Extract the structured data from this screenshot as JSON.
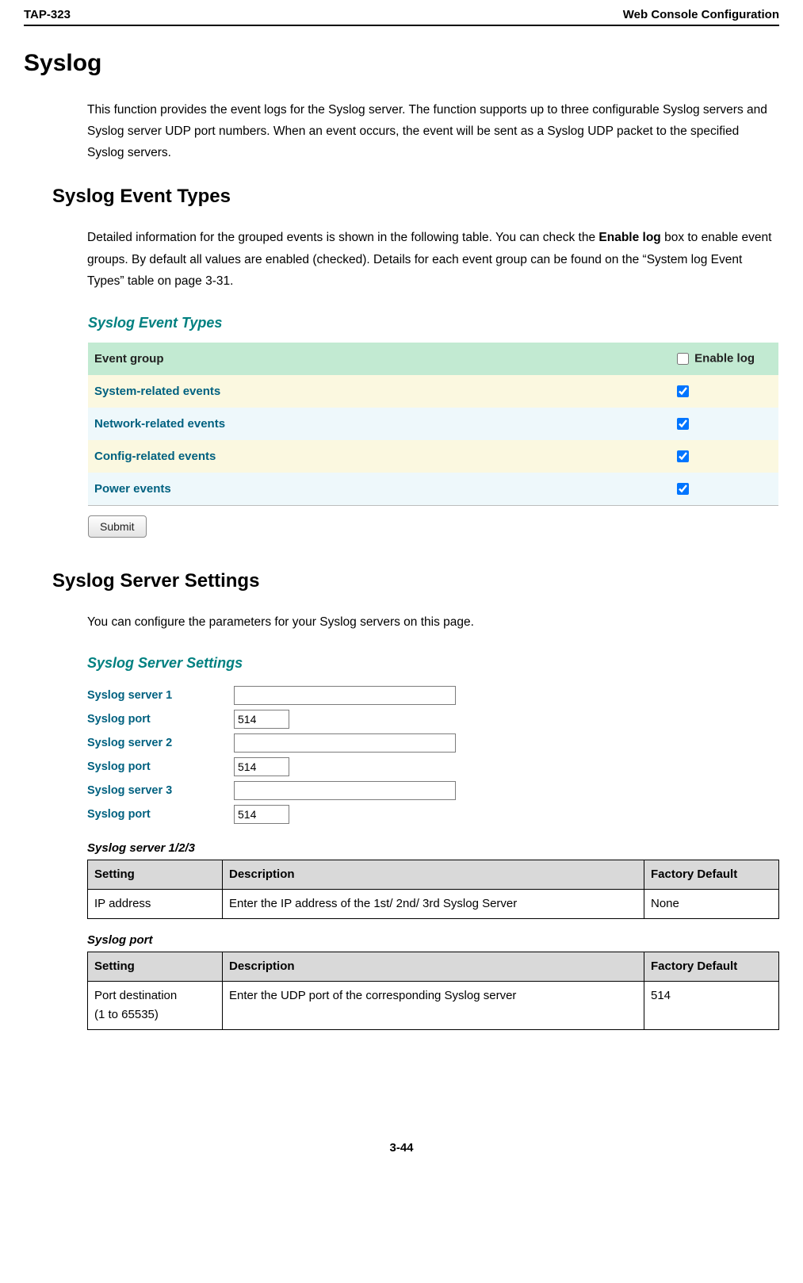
{
  "header": {
    "left": "TAP-323",
    "right": "Web Console Configuration"
  },
  "h1": "Syslog",
  "intro": "This function provides the event logs for the Syslog server. The function supports up to three configurable Syslog servers and Syslog server UDP port numbers. When an event occurs, the event will be sent as a Syslog UDP packet to the specified Syslog servers.",
  "h2_event_types": "Syslog Event Types",
  "event_types_text_pre": "Detailed information for the grouped events is shown in the following table. You can check the ",
  "event_types_text_bold": "Enable log",
  "event_types_text_post": " box to enable event groups. By default all values are enabled (checked). Details for each event group can be found on the “System log Event Types” table on page 3-31.",
  "panel_event_types": {
    "title": "Syslog Event Types",
    "header_group": "Event group",
    "header_enable": "Enable log",
    "rows": [
      {
        "label": "System-related events",
        "checked": true
      },
      {
        "label": "Network-related events",
        "checked": true
      },
      {
        "label": "Config-related events",
        "checked": true
      },
      {
        "label": "Power events",
        "checked": true
      }
    ],
    "submit": "Submit"
  },
  "h2_server_settings": "Syslog Server Settings",
  "server_settings_text": "You can configure the parameters for your Syslog servers on this page.",
  "panel_server": {
    "title": "Syslog Server Settings",
    "rows": [
      {
        "label": "Syslog server 1",
        "value": "",
        "type": "long"
      },
      {
        "label": "Syslog port",
        "value": "514",
        "type": "short"
      },
      {
        "label": "Syslog server 2",
        "value": "",
        "type": "long"
      },
      {
        "label": "Syslog port",
        "value": "514",
        "type": "short"
      },
      {
        "label": "Syslog server 3",
        "value": "",
        "type": "long"
      },
      {
        "label": "Syslog port",
        "value": "514",
        "type": "short"
      }
    ]
  },
  "table1": {
    "caption": "Syslog server 1/2/3",
    "headers": {
      "setting": "Setting",
      "desc": "Description",
      "default": "Factory Default"
    },
    "row": {
      "setting": "IP address",
      "desc": "Enter the IP address of the 1st/ 2nd/ 3rd Syslog Server",
      "default": "None"
    }
  },
  "table2": {
    "caption": "Syslog port",
    "headers": {
      "setting": "Setting",
      "desc": "Description",
      "default": "Factory Default"
    },
    "row": {
      "setting_line1": "Port destination",
      "setting_line2": "(1 to 65535)",
      "desc": "Enter the UDP port of the corresponding Syslog server",
      "default": "514"
    }
  },
  "footer": "3-44"
}
